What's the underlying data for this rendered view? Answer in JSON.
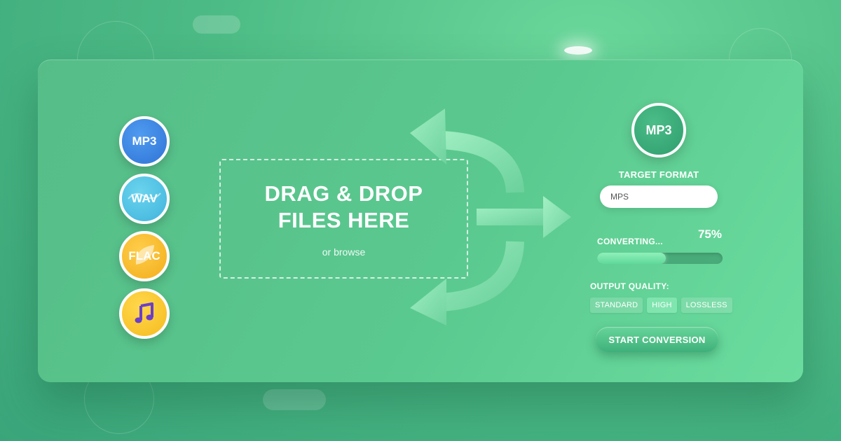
{
  "formats": [
    {
      "label": "MP3",
      "icon": "mp3-icon"
    },
    {
      "label": "WAV",
      "icon": "wav-icon"
    },
    {
      "label": "FLAC",
      "icon": "flac-icon"
    },
    {
      "label": "",
      "icon": "music-note-icon"
    }
  ],
  "dropzone": {
    "title": "DRAG & DROP FILES HERE",
    "subtitle": "or browse"
  },
  "panel": {
    "target_circle_label": "MP3",
    "target_format_label": "TARGET FORMAT",
    "search_value": "MPS",
    "progress": {
      "label": "CONVERTING...",
      "percent_text": "75%",
      "fraction": 0.55
    },
    "quality": {
      "label": "OUTPUT QUALITY:",
      "options": [
        "STANDARD",
        "HIGH",
        "LOSSLESS"
      ],
      "selected": "HIGH"
    },
    "start_label": "START CONVERSION"
  },
  "colors": {
    "mp3": "#2f74d6",
    "wav": "#3fb3dc",
    "flac": "#f2ae1c",
    "note": "#f5bb1d",
    "note_glyph": "#6a3fc9",
    "accent": "#5ac98f"
  }
}
